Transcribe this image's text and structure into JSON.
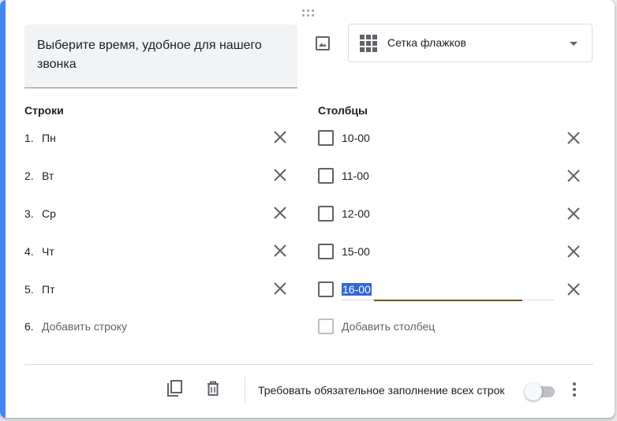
{
  "question": {
    "title": "Выберите время, удобное для нашего звонка"
  },
  "question_type": {
    "label": "Сетка флажков",
    "icon": "grid-icon"
  },
  "rows_section": {
    "title": "Строки",
    "items": [
      {
        "number": "1.",
        "label": "Пн"
      },
      {
        "number": "2.",
        "label": "Вт"
      },
      {
        "number": "3.",
        "label": "Ср"
      },
      {
        "number": "4.",
        "label": "Чт"
      },
      {
        "number": "5.",
        "label": "Пт"
      }
    ],
    "add": {
      "number": "6.",
      "label": "Добавить строку"
    }
  },
  "columns_section": {
    "title": "Столбцы",
    "items": [
      {
        "label": "10-00"
      },
      {
        "label": "11-00"
      },
      {
        "label": "12-00"
      },
      {
        "label": "15-00"
      },
      {
        "label": "16-00"
      }
    ],
    "add": {
      "label": "Добавить столбец"
    }
  },
  "footer": {
    "required_label": "Требовать обязательное заполнение всех строк",
    "required_on": false
  },
  "colors": {
    "accent": "#4285f4",
    "selection": "#3367d6"
  }
}
